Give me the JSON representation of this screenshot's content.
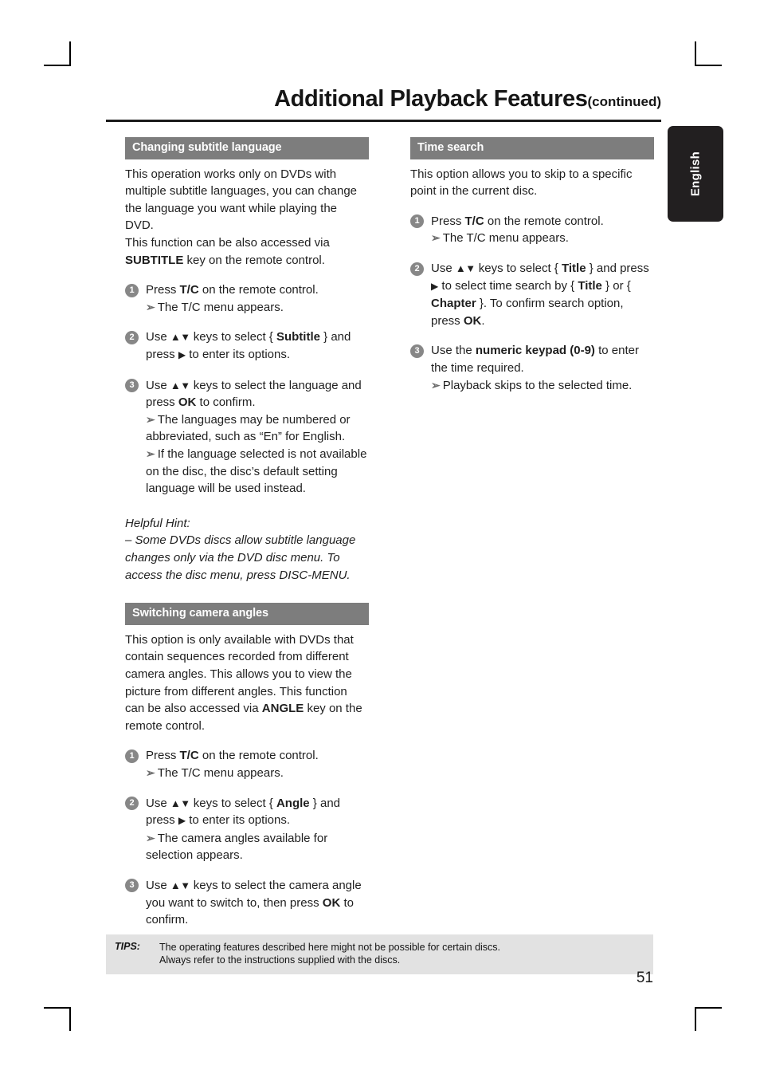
{
  "header": {
    "title": "Additional Playback Features",
    "continued": "(continued)"
  },
  "side_tab": {
    "label": "English"
  },
  "left_column": {
    "section1": {
      "heading": "Changing subtitle language",
      "intro": "This operation works only on DVDs with multiple subtitle languages, you can change the language you want while playing the DVD.",
      "intro2_prefix": "This function can be also accessed via ",
      "intro2_key": "SUBTITLE",
      "intro2_suffix": " key on the remote control.",
      "steps": [
        {
          "num": "1",
          "line_a": "Press ",
          "key_a": "T/C",
          "line_b": " on the remote control.",
          "result": "The T/C menu appears."
        },
        {
          "num": "2",
          "line_a": "Use ",
          "keys": "▲▼",
          "line_b": " keys to select { ",
          "option": "Subtitle",
          "line_c": " } and press ",
          "tri": "▶",
          "line_d": " to enter its options."
        },
        {
          "num": "3",
          "line_a": "Use ",
          "keys": "▲▼",
          "line_b": " keys to select the language and press ",
          "key_ok": "OK",
          "line_c": " to confirm.",
          "result1": "The languages may be numbered or abbreviated, such as “En” for English.",
          "result2": "If the language selected is not available on the disc, the disc’s default setting language will be used instead."
        }
      ],
      "hint_title": "Helpful Hint:",
      "hint_body": "– Some DVDs discs allow subtitle language changes only via the DVD disc menu. To access the disc menu, press DISC-MENU."
    },
    "section2": {
      "heading": "Switching camera angles",
      "intro": "This option is only available with DVDs that contain sequences recorded from different camera angles. This allows you to view the picture from different angles.",
      "intro2_prefix": "This function can be also accessed via ",
      "intro2_key": "ANGLE",
      "intro2_suffix": " key on the remote control.",
      "steps": [
        {
          "num": "1",
          "line_a": "Press ",
          "key_a": "T/C",
          "line_b": " on the remote control.",
          "result": "The T/C menu appears."
        },
        {
          "num": "2",
          "line_a": "Use ",
          "keys": "▲▼",
          "line_b": " keys to select { ",
          "option": "Angle",
          "line_c": " } and press ",
          "tri": "▶",
          "line_d": " to enter its options.",
          "result": "The camera angles available for selection appears."
        },
        {
          "num": "3",
          "line_a": "Use ",
          "keys": "▲▼",
          "line_b": " keys to select the camera angle you want to switch to, then press ",
          "key_ok": "OK",
          "line_c": " to confirm."
        }
      ]
    }
  },
  "right_column": {
    "section1": {
      "heading": "Time search",
      "intro": "This option allows you to skip to a specific point in the current disc.",
      "steps": [
        {
          "num": "1",
          "line_a": "Press ",
          "key_a": "T/C",
          "line_b": " on the remote control.",
          "result": "The T/C menu appears."
        },
        {
          "num": "2",
          "line_a": "Use ",
          "keys": "▲▼",
          "line_b": " keys to select { ",
          "option": "Title",
          "line_c": " } and press ",
          "tri": "▶",
          "line_d": " to select time search by { ",
          "option2": "Title",
          "line_e": " } or { ",
          "option3": "Chapter",
          "line_f": " }. To confirm search option, press ",
          "key_ok": "OK",
          "line_g": "."
        },
        {
          "num": "3",
          "line_a": "Use the ",
          "key_a": "numeric keypad (0-9)",
          "line_b": " to enter the time required.",
          "result": "Playback skips to the selected time."
        }
      ]
    }
  },
  "footer": {
    "tips_label": "TIPS:",
    "tips_line1": "The operating features described here might not be possible for certain discs.",
    "tips_line2": "Always refer to the instructions supplied with the discs.",
    "page_number": "51"
  }
}
